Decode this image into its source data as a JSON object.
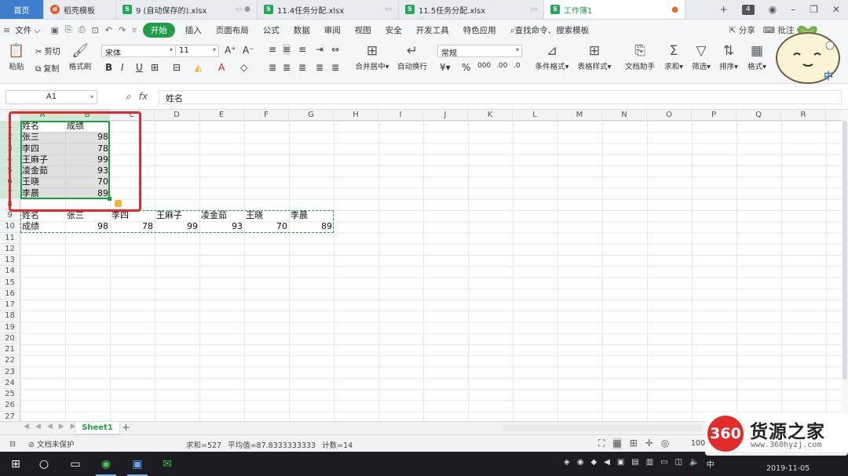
{
  "tabs": [
    {
      "label": "首页",
      "type": "home"
    },
    {
      "label": "稻壳模板",
      "icon": "d"
    },
    {
      "label": "9 (自动保存的).xlsx",
      "icon": "s"
    },
    {
      "label": "11.4任务分配.xlsx",
      "icon": "s"
    },
    {
      "label": "11.5任务分配.xlsx",
      "icon": "s"
    },
    {
      "label": "工作簿1",
      "icon": "s",
      "active": true
    }
  ],
  "tab_count": "4",
  "menu": {
    "file": "文件",
    "start": "开始",
    "items": [
      "插入",
      "页面布局",
      "公式",
      "数据",
      "审阅",
      "视图",
      "安全",
      "开发工具",
      "特色应用"
    ],
    "search": "查找命令、搜索模板",
    "share": "分享",
    "comment": "批注"
  },
  "ribbon": {
    "paste": "粘贴",
    "cut": "剪切",
    "copy": "复制",
    "format_painter": "格式刷",
    "font_name": "宋体",
    "font_size": "11",
    "merge_center": "合并居中",
    "wrap_text": "自动换行",
    "number_format": "常规",
    "conditional_format": "条件格式",
    "table_style": "表格样式",
    "doc_helper": "文档助手",
    "sum": "求和",
    "filter": "筛选",
    "sort": "排序",
    "format": "格式"
  },
  "mascot_text": "中",
  "formula_bar": {
    "cell_ref": "A1",
    "fx": "fx",
    "content": "姓名"
  },
  "columns": [
    "A",
    "B",
    "C",
    "D",
    "E",
    "F",
    "G",
    "H",
    "I",
    "J",
    "K",
    "L",
    "M",
    "N",
    "O",
    "P",
    "Q",
    "R"
  ],
  "rows": [
    "1",
    "2",
    "3",
    "4",
    "5",
    "6",
    "7",
    "8",
    "9",
    "10",
    "11",
    "12",
    "13",
    "14",
    "15",
    "16",
    "17",
    "18",
    "19",
    "20",
    "21",
    "22",
    "23",
    "24",
    "25",
    "26",
    "27"
  ],
  "sheet_data": {
    "header": [
      "姓名",
      "成绩"
    ],
    "records": [
      {
        "name": "张三",
        "score": "98"
      },
      {
        "name": "李四",
        "score": "78"
      },
      {
        "name": "王麻子",
        "score": "99"
      },
      {
        "name": "凌金茹",
        "score": "93"
      },
      {
        "name": "王晓",
        "score": "70"
      },
      {
        "name": "李晨",
        "score": "89"
      }
    ],
    "transposed_labels": [
      "姓名",
      "成绩"
    ]
  },
  "sheet_tab": "Sheet1",
  "status": {
    "protect": "文档未保护",
    "sum": "求和=527",
    "avg": "平均值=87.8333333333",
    "count": "计数=14",
    "zoom": "100%"
  },
  "taskbar": {
    "date": "2019-11-05"
  },
  "watermark": {
    "logo": "360",
    "title": "货源之家",
    "url": "www.360hyzj.com"
  },
  "colors": {
    "accent": "#1f9e47",
    "selection_border": "#1f9e47",
    "annotation": "#e8262f",
    "home_tab": "#3d7fcc"
  }
}
